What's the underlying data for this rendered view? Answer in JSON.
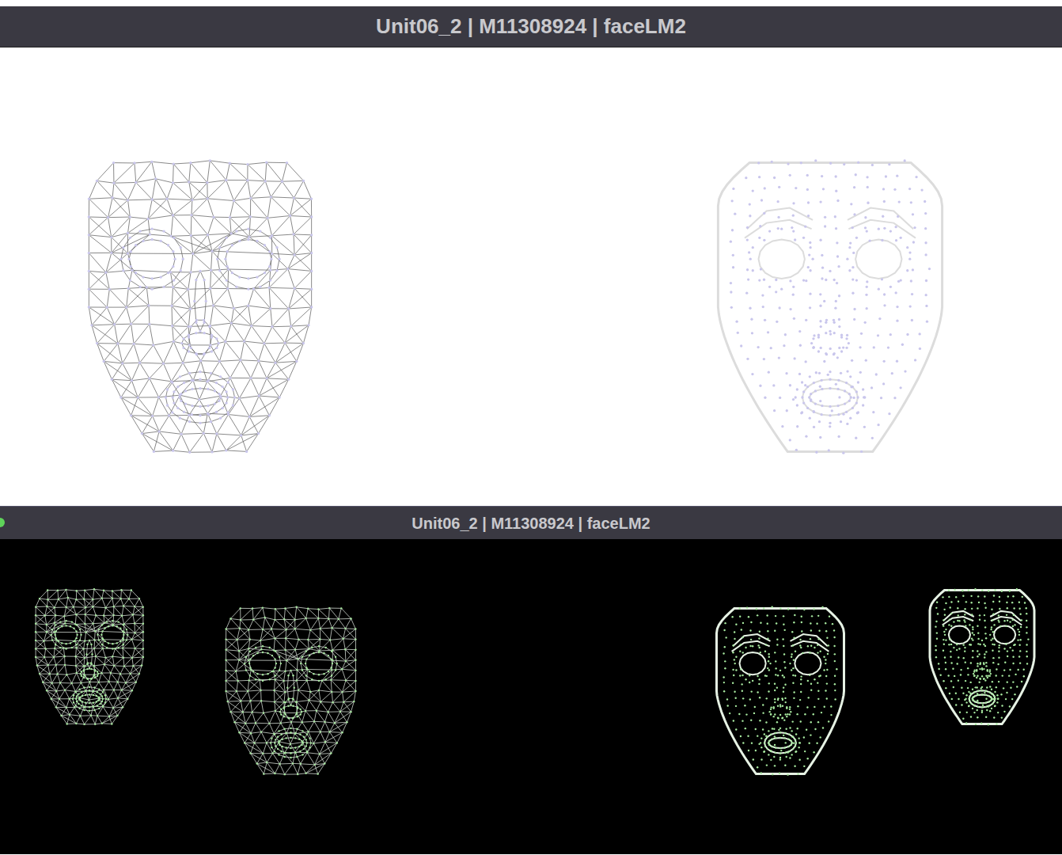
{
  "windows": [
    {
      "title": "Unit06_2 | M11308924 | faceLM2",
      "kind": "light",
      "dot": false,
      "faces": [
        {
          "kind": "mesh"
        },
        {
          "kind": "points"
        }
      ]
    },
    {
      "title": "Unit06_2 | M11308924 | faceLM2",
      "kind": "dark",
      "dot": true,
      "faces": [
        {
          "kind": "mesh"
        },
        {
          "kind": "mesh"
        },
        {
          "kind": "points"
        },
        {
          "kind": "points"
        }
      ]
    }
  ]
}
